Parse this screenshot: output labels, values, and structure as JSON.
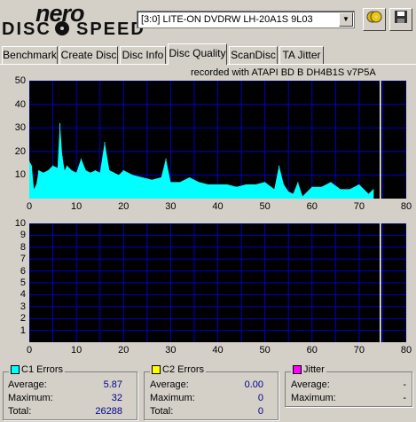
{
  "app": {
    "logo_top": "nero",
    "logo_left": "DISC",
    "logo_right": "SPEED"
  },
  "drive": {
    "selected": "[3:0]   LITE-ON DVDRW LH-20A1S 9L03"
  },
  "tabs": [
    {
      "label": "Benchmark"
    },
    {
      "label": "Create Disc"
    },
    {
      "label": "Disc Info"
    },
    {
      "label": "Disc Quality",
      "active": true
    },
    {
      "label": "ScanDisc"
    },
    {
      "label": "TA Jitter"
    }
  ],
  "recorded_with": "recorded with ATAPI   BD   B   DH4B1S     v7P5A",
  "chart_data": [
    {
      "type": "area",
      "name": "C1 Errors",
      "x_ticks": [
        0,
        10,
        20,
        30,
        40,
        50,
        60,
        70,
        80
      ],
      "y_ticks": [
        10,
        20,
        30,
        40,
        50
      ],
      "xlim": [
        0,
        80
      ],
      "ylim": [
        0,
        50
      ],
      "grid": true,
      "background": "#000000",
      "grid_color": "#0000c8",
      "fill_color": "#00ffff",
      "marker_x": 74.5,
      "x": [
        0,
        0.5,
        1,
        1.5,
        2,
        3,
        4,
        5,
        6,
        6.5,
        7,
        7.5,
        8,
        9,
        10,
        11,
        12,
        13,
        14,
        15,
        16,
        17,
        18,
        19,
        20,
        22,
        24,
        26,
        28,
        29,
        30,
        32,
        34,
        36,
        38,
        40,
        42,
        44,
        46,
        48,
        50,
        52,
        53,
        54,
        55,
        56,
        57,
        58,
        60,
        62,
        64,
        66,
        68,
        70,
        72,
        73
      ],
      "values": [
        16,
        14,
        4,
        6,
        12,
        11,
        12,
        14,
        13,
        32,
        18,
        12,
        14,
        12,
        11,
        17,
        12,
        11,
        12,
        11,
        24,
        12,
        11,
        10,
        12,
        10,
        9,
        8,
        9,
        17,
        7,
        7,
        9,
        7,
        6,
        6,
        6,
        5,
        6,
        6,
        7,
        4,
        14,
        6,
        3,
        2,
        7,
        1,
        5,
        5,
        7,
        4,
        4,
        6,
        2,
        4
      ]
    },
    {
      "type": "area",
      "name": "C2 Errors",
      "x_ticks": [
        0,
        10,
        20,
        30,
        40,
        50,
        60,
        70,
        80
      ],
      "y_ticks": [
        1,
        2,
        3,
        4,
        5,
        6,
        7,
        8,
        9,
        10
      ],
      "xlim": [
        0,
        80
      ],
      "ylim": [
        0,
        10
      ],
      "grid": true,
      "background": "#000000",
      "grid_color": "#0000c8",
      "marker_x": 74.5,
      "x": [],
      "values": []
    }
  ],
  "stats": {
    "c1": {
      "title": "C1 Errors",
      "color": "#00ffff",
      "avg_label": "Average:",
      "avg": "5.87",
      "max_label": "Maximum:",
      "max": "32",
      "total_label": "Total:",
      "total": "26288"
    },
    "c2": {
      "title": "C2 Errors",
      "color": "#ffff00",
      "avg_label": "Average:",
      "avg": "0.00",
      "max_label": "Maximum:",
      "max": "0",
      "total_label": "Total:",
      "total": "0"
    },
    "jitter": {
      "title": "Jitter",
      "color": "#ff00ff",
      "avg_label": "Average:",
      "avg": "-",
      "max_label": "Maximum:",
      "max": "-"
    }
  }
}
